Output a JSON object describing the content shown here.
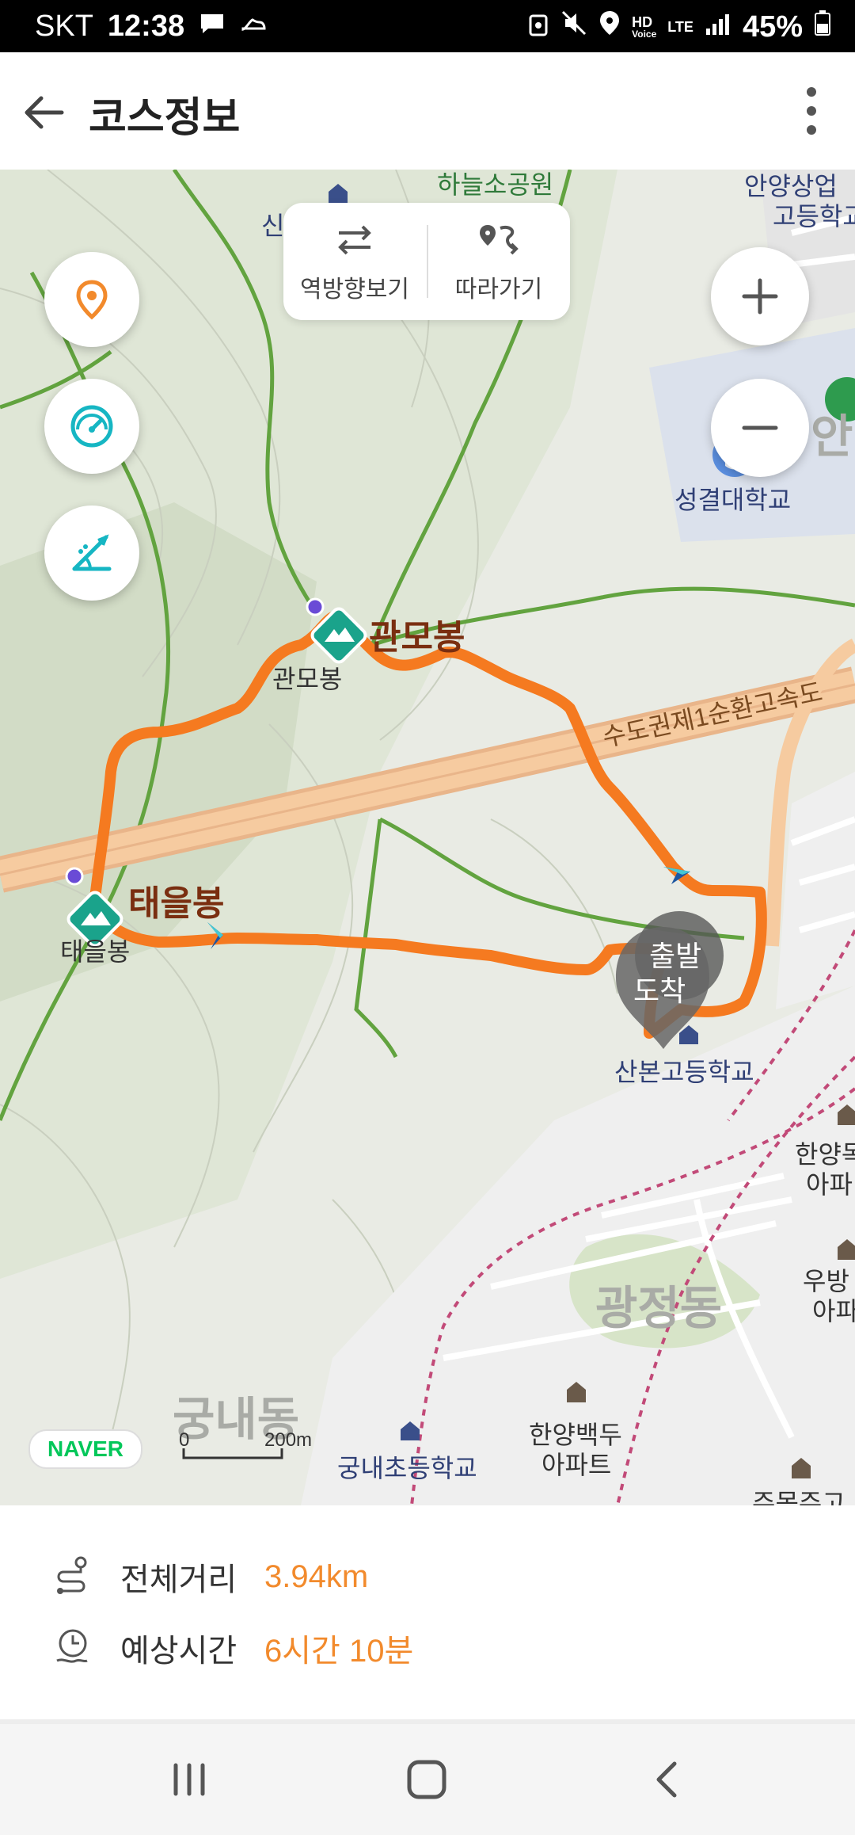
{
  "status": {
    "carrier": "SKT",
    "time": "12:38",
    "battery": "45%",
    "net_hd": "HD",
    "net_voice": "Voice",
    "net_lte": "LTE"
  },
  "appbar": {
    "title": "코스정보",
    "back_icon": "arrow-left-icon",
    "more_icon": "more-vertical-icon"
  },
  "map": {
    "toolbar": {
      "reverse_label": "역방향보기",
      "follow_label": "따라가기"
    },
    "labels": {
      "park_top": "하늘소공원",
      "school_top_right_1": "안양상업",
      "school_top_right_2": "고등학교",
      "partial_top_left": "신",
      "university": "성결대학교",
      "partial_right": "안",
      "peak1_big": "관모봉",
      "peak1_small": "관모봉",
      "peak2_big": "태을봉",
      "peak2_small": "태을봉",
      "highway": "수도권제1순환고속도",
      "start": "출발",
      "end": "도착",
      "highschool": "산본고등학교",
      "apt_right_1": "한양목",
      "apt_right_1b": "아파",
      "apt_right_2": "우방",
      "apt_right_2b": "아파",
      "district_main": "광정동",
      "district_left": "궁내동",
      "elementary": "궁내초등학교",
      "apt_bottom_1": "한양백두",
      "apt_bottom_2": "아파트",
      "partial_bottom_right": "주몽주고"
    },
    "naver": "NAVER",
    "scale_zero": "0",
    "scale_distance": "200m"
  },
  "info": {
    "distance_label": "전체거리",
    "distance_value": "3.94km",
    "time_label": "예상시간",
    "time_value": "6시간 10분"
  },
  "colors": {
    "route": "#f57a20",
    "peak_icon": "#1aa38b",
    "accent_orange": "#f28a2c",
    "teal": "#16b6c3"
  }
}
